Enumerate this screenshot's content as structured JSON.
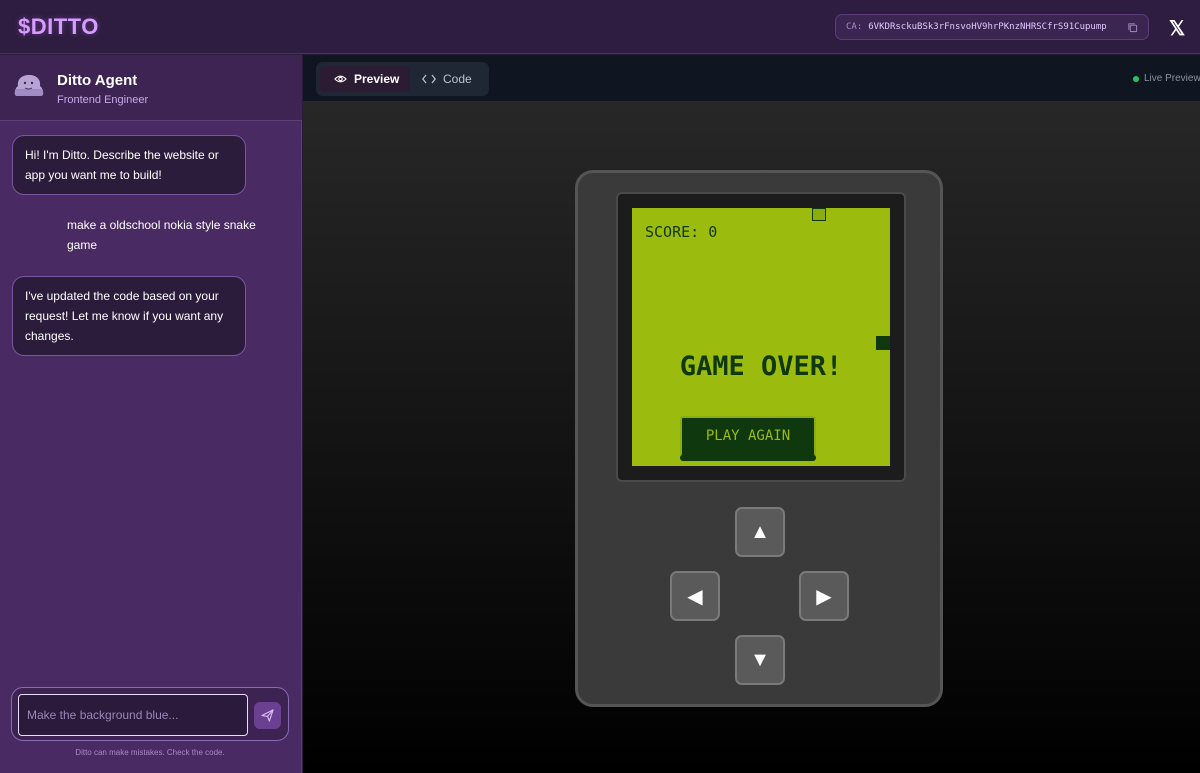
{
  "topbar": {
    "brand": "$DITTO",
    "ca_label": "CA:",
    "ca_value": "6VKDRsckuBSk3rFnsvoHV9hrPKnzNHRSCfrS91Cupump",
    "x_glyph": "𝕏"
  },
  "sidebar": {
    "agent_name": "Ditto Agent",
    "agent_role": "Frontend Engineer",
    "messages": [
      {
        "role": "agent",
        "text": "Hi! I'm Ditto. Describe the website or app you want me to build!"
      },
      {
        "role": "user",
        "text": "make a oldschool nokia style snake game"
      },
      {
        "role": "agent",
        "text": "I've updated the code based on your request! Let me know if you want any changes."
      }
    ],
    "input_placeholder": "Make the background blue...",
    "disclaimer": "Ditto can make mistakes. Check the code."
  },
  "tabs": {
    "preview": "Preview",
    "code": "Code",
    "live": "Live Preview"
  },
  "game": {
    "score_text": "SCORE: 0",
    "game_over": "GAME OVER!",
    "play_again": "PLAY AGAIN",
    "dpad": {
      "up": "▲",
      "left": "◀",
      "right": "▶",
      "down": "▼"
    }
  },
  "colors": {
    "brand": "#d79cff",
    "lcd": "#9bbc0f",
    "lcd_dark": "#0f380f",
    "live_dot": "#22c55e"
  }
}
